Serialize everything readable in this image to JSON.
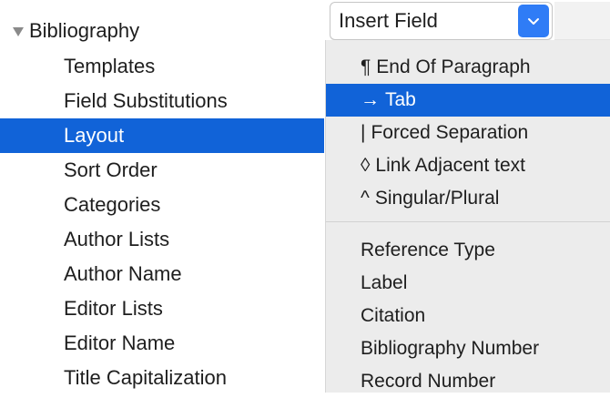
{
  "sidebar": {
    "parent": {
      "label": "Bibliography",
      "icon": "disclosure-triangle-down-icon"
    },
    "items": [
      {
        "label": "Templates"
      },
      {
        "label": "Field Substitutions"
      },
      {
        "label": "Layout",
        "selected": true
      },
      {
        "label": "Sort Order"
      },
      {
        "label": "Categories"
      },
      {
        "label": "Author Lists"
      },
      {
        "label": "Author Name"
      },
      {
        "label": "Editor Lists"
      },
      {
        "label": "Editor Name"
      },
      {
        "label": "Title Capitalization"
      }
    ]
  },
  "popup": {
    "label": "Insert Field",
    "icon": "chevron-down-icon"
  },
  "menu": {
    "special_items": [
      {
        "symbol": "¶",
        "label": "End Of Paragraph"
      },
      {
        "symbol": "→",
        "label": "Tab",
        "highlighted": true
      },
      {
        "symbol": "|",
        "label": "Forced Separation"
      },
      {
        "symbol": "◊",
        "label": "Link Adjacent text"
      },
      {
        "symbol": "^",
        "label": "Singular/Plural"
      }
    ],
    "field_items": [
      {
        "label": "Reference Type"
      },
      {
        "label": "Label"
      },
      {
        "label": "Citation"
      },
      {
        "label": "Bibliography Number"
      },
      {
        "label": "Record Number"
      }
    ]
  },
  "colors": {
    "selection": "#1163d8",
    "popup_accent": "#2f7cf6",
    "menu_background": "#ececec"
  }
}
